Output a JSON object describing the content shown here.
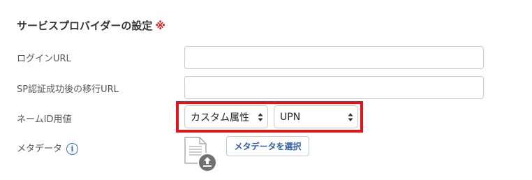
{
  "section": {
    "title": "サービスプロバイダーの設定",
    "required_mark": "※"
  },
  "fields": {
    "login_url": {
      "label": "ログインURL",
      "value": ""
    },
    "redirect_url": {
      "label": "SP認証成功後の移行URL",
      "value": ""
    },
    "name_id": {
      "label": "ネームID用値",
      "attribute_select_value": "カスタム属性",
      "value_select_value": "UPN"
    },
    "metadata": {
      "label": "メタデータ",
      "info_icon": "i",
      "select_button_label": "メタデータを選択"
    }
  },
  "icons": {
    "info": "info-icon",
    "file": "file-icon",
    "upload": "upload-icon",
    "select_arrows": "select-arrows-icon"
  },
  "colors": {
    "required_mark": "#e02020",
    "highlight_border": "#e4121b",
    "link_blue": "#2f5fa8",
    "info_blue": "#2f6fd1",
    "upload_badge": "#707070"
  }
}
